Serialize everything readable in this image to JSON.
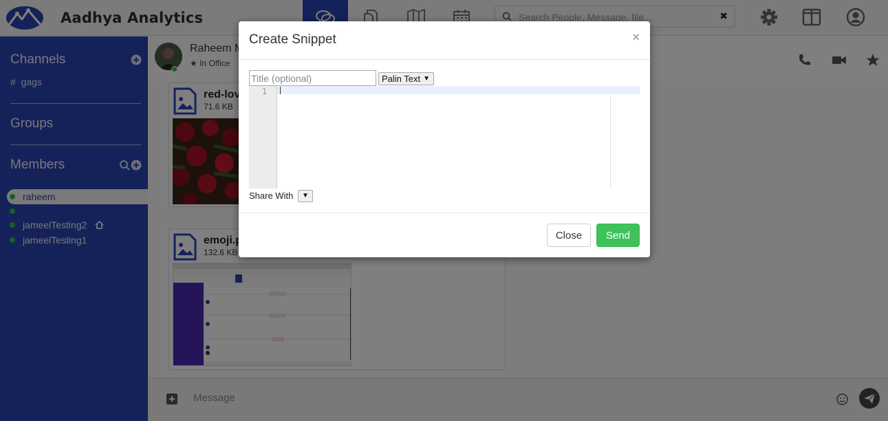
{
  "app": {
    "brand": "Aadhya Analytics"
  },
  "header": {
    "nav_tabs": [
      {
        "name": "chat",
        "active": true
      },
      {
        "name": "files",
        "active": false
      },
      {
        "name": "map",
        "active": false
      },
      {
        "name": "calendar",
        "active": false
      }
    ],
    "search": {
      "placeholder": "Search People, Message, file...",
      "clear": "✖"
    },
    "icons": [
      "settings",
      "layout",
      "profile"
    ]
  },
  "sidebar": {
    "channels": {
      "title": "Channels",
      "items": [
        "gags"
      ],
      "prefix": "#"
    },
    "groups": {
      "title": "Groups"
    },
    "members": {
      "title": "Members",
      "items": [
        {
          "label": "raheem",
          "selected": true
        },
        {
          "label": "",
          "selected": false
        },
        {
          "label": "jameelTesting2",
          "selected": false,
          "home": true
        },
        {
          "label": "jameelTesting1",
          "selected": false
        }
      ]
    }
  },
  "chat": {
    "peer_name": "Raheem M",
    "peer_status": "In Office",
    "files": [
      {
        "name": "red-lov",
        "size": "71.6 KB"
      },
      {
        "name": "emoji.p",
        "size": "132.6 KB"
      }
    ],
    "composer_placeholder": "Message"
  },
  "modal": {
    "title": "Create Snippet",
    "close_x": "×",
    "title_placeholder": "Title (optional)",
    "language": "Palin Text",
    "line_number": "1",
    "share_label": "Share With",
    "share_arrow": "▼",
    "close_button": "Close",
    "send_button": "Send"
  },
  "colors": {
    "primary": "#2b45b2",
    "send": "#40c25a",
    "online": "#2fbf4b"
  }
}
